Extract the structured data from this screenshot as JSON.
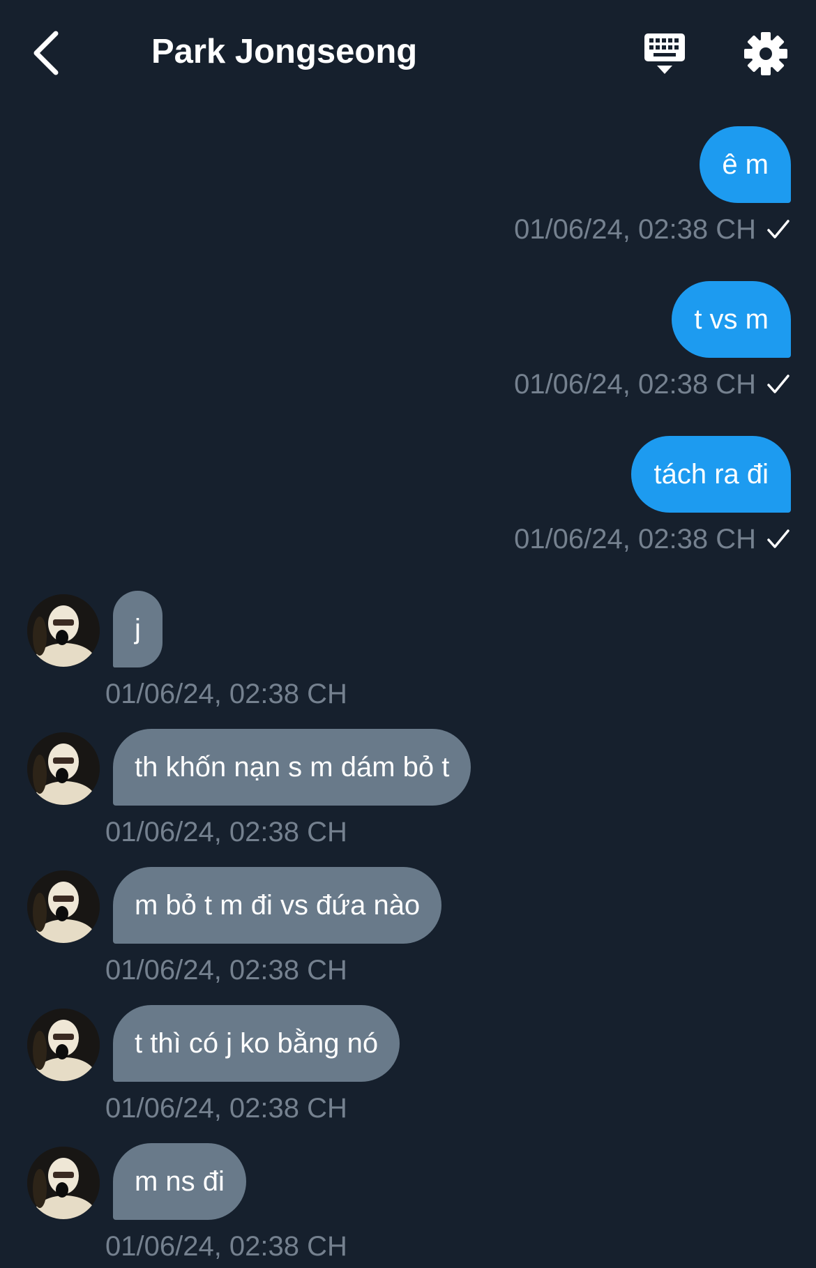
{
  "header": {
    "title": "Park Jongseong",
    "back_icon": "chevron-left-icon",
    "keyboard_icon": "keyboard-icon",
    "settings_icon": "gear-icon"
  },
  "colors": {
    "background": "#16202d",
    "outgoing_bubble": "#1d9bf0",
    "incoming_bubble": "#697a8a",
    "timestamp": "#75818f"
  },
  "messages": [
    {
      "direction": "outgoing",
      "text": "ê m",
      "time": "01/06/24, 02:38 CH",
      "read": true
    },
    {
      "direction": "outgoing",
      "text": "t vs m",
      "time": "01/06/24, 02:38 CH",
      "read": true
    },
    {
      "direction": "outgoing",
      "text": "tách ra đi",
      "time": "01/06/24, 02:38 CH",
      "read": true
    },
    {
      "direction": "incoming",
      "text": "j",
      "time": "01/06/24, 02:38 CH"
    },
    {
      "direction": "incoming",
      "text": "th khốn nạn s m dám bỏ t",
      "time": "01/06/24, 02:38 CH"
    },
    {
      "direction": "incoming",
      "text": "m bỏ t m đi vs đứa nào",
      "time": "01/06/24, 02:38 CH"
    },
    {
      "direction": "incoming",
      "text": "t thì có j ko bằng nó",
      "time": "01/06/24, 02:38 CH"
    },
    {
      "direction": "incoming",
      "text": "m ns đi",
      "time": "01/06/24, 02:38 CH"
    }
  ]
}
